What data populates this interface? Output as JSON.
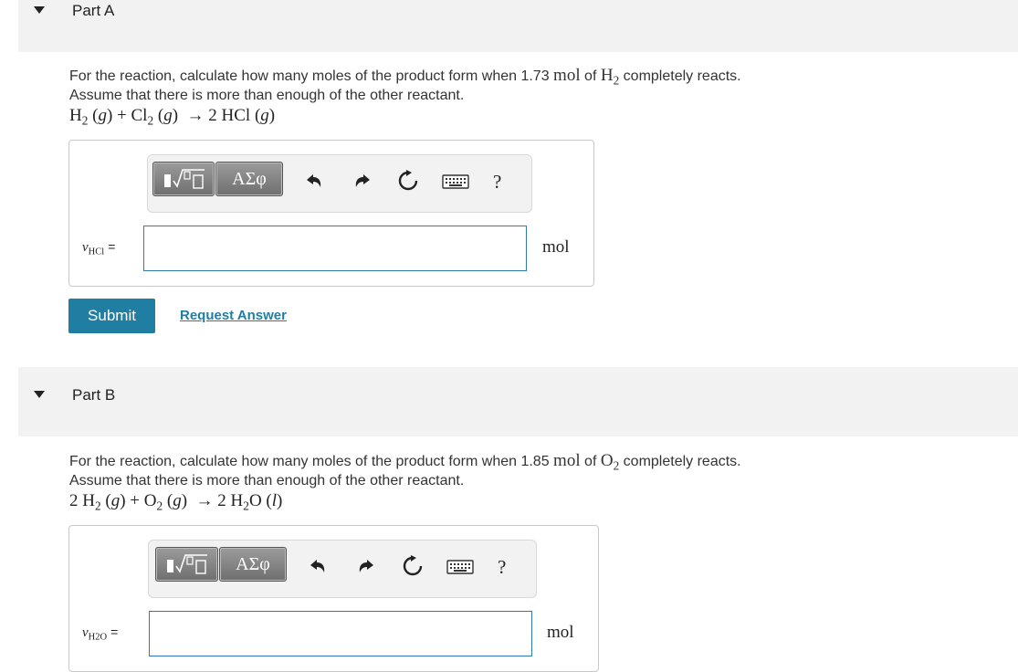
{
  "part_a": {
    "title": "Part A",
    "question_line1_pre": "For the reaction, calculate how many moles of the product form when 1.73 ",
    "question_line1_unit": "mol",
    "question_line1_mid": " of ",
    "question_line1_species": "H",
    "question_line1_species_sub": "2",
    "question_line1_post": " completely reacts.",
    "question_line2": "Assume that there is more than enough of the other reactant.",
    "answer_variable": "HCl",
    "answer_value": "",
    "unit": "mol",
    "submit_label": "Submit",
    "request_label": "Request Answer"
  },
  "part_b": {
    "title": "Part B",
    "question_line1_pre": "For the reaction, calculate how many moles of the product form when 1.85 ",
    "question_line1_unit": "mol",
    "question_line1_mid": " of ",
    "question_line1_species": "O",
    "question_line1_species_sub": "2",
    "question_line1_post": " completely reacts.",
    "question_line2": "Assume that there is more than enough of the other reactant.",
    "answer_variable": "H2O",
    "answer_value": "",
    "unit": "mol"
  },
  "toolbar": {
    "greek_label": "ΑΣφ",
    "help_label": "?",
    "icons": [
      "templates-icon",
      "greek-letters-icon",
      "undo-icon",
      "redo-icon",
      "reset-icon",
      "keyboard-icon",
      "help-icon"
    ]
  },
  "colors": {
    "header_bg": "#f2f2f2",
    "accent": "#1f7ea1",
    "input_border": "#2e7bb3"
  }
}
